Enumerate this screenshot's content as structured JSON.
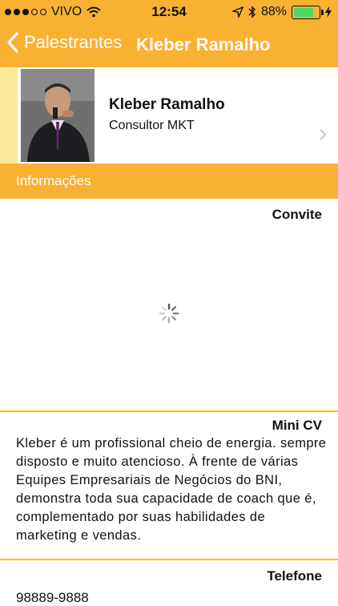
{
  "status_bar": {
    "carrier": "VIVO",
    "time": "12:54",
    "battery": "88%",
    "battery_level": 0.88
  },
  "nav": {
    "back_label": "Palestrantes",
    "title": "Kleber Ramalho"
  },
  "profile": {
    "name": "Kleber Ramalho",
    "role": "Consultor MKT"
  },
  "info_header": "Informações",
  "sections": {
    "convite_label": "Convite",
    "minicv_label": "Mini CV",
    "minicv_text": "Kleber é um profissional cheio de energia. sempre disposto e muito atencioso. À frente de várias Equipes Empresariais de Negócios do BNI, demonstra toda sua capacidade de coach que é, complementado por suas habilidades de marketing e vendas.",
    "telefone_label": "Telefone",
    "telefone_value": "98889-9888"
  },
  "colors": {
    "accent": "#f8b133",
    "divider": "#f6c600",
    "photo_strip": "#fde89a"
  },
  "icons": [
    "signal-dots-icon",
    "wifi-icon",
    "location-arrow-icon",
    "bluetooth-icon",
    "battery-icon",
    "charging-bolt-icon",
    "back-chevron-icon",
    "disclosure-chevron-icon",
    "loading-spinner-icon"
  ]
}
